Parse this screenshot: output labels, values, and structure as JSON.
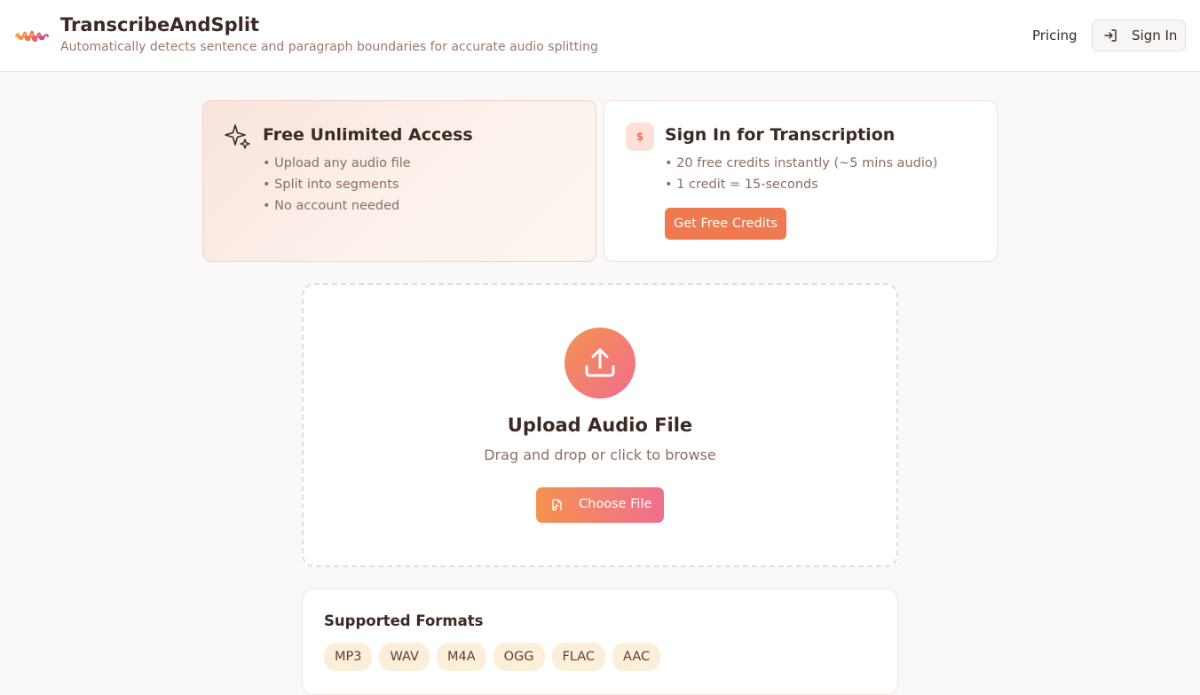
{
  "header": {
    "title": "TranscribeAndSplit",
    "subtitle": "Automatically detects sentence and paragraph boundaries for accurate audio splitting",
    "nav_pricing": "Pricing",
    "signin_label": "Sign In"
  },
  "cards": {
    "free": {
      "title": "Free Unlimited Access",
      "items": [
        "• Upload any audio file",
        "• Split into segments",
        "• No account needed"
      ]
    },
    "signin": {
      "badge": "$",
      "title": "Sign In for Transcription",
      "items": [
        "• 20 free credits instantly (~5 mins audio)",
        "• 1 credit = 15-seconds"
      ],
      "button_label": "Get Free Credits"
    }
  },
  "upload": {
    "title": "Upload Audio File",
    "hint": "Drag and drop or click to browse",
    "button_label": "Choose File"
  },
  "formats": {
    "title": "Supported Formats",
    "list": [
      "MP3",
      "WAV",
      "M4A",
      "OGG",
      "FLAC",
      "AAC"
    ]
  },
  "icons": {
    "logo": "waveform-logo-icon",
    "signin": "sign-in-arrow-icon",
    "free_card": "sparkles-icon",
    "upload": "upload-icon",
    "choose": "audio-file-icon"
  },
  "colors": {
    "accent": "#ef7a50",
    "gradient_start": "#f5924e",
    "gradient_end": "#f06e8f",
    "chip_bg": "#fcefd9"
  }
}
